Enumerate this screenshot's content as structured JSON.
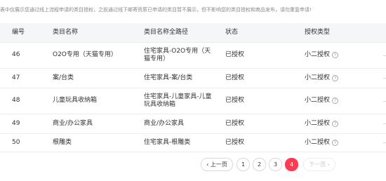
{
  "notice": "表中仅展示您通过线上流程申请的类目授权，之前通过线下邮寄资质已申请的类目暂不展示，但不影响您的类目授权和商品发布，请勿重复申请!",
  "table": {
    "columns": [
      "编号",
      "类目名称",
      "类目名称全路径",
      "状态",
      "授权类型"
    ],
    "rows": [
      {
        "id": "46",
        "name": "O2O专用（天猫专用）",
        "path": "住宅家具-O2O专用（天猫专用）",
        "status": "已授权",
        "type": "小二授权"
      },
      {
        "id": "47",
        "name": "案/台类",
        "path": "住宅家具-案/台类",
        "status": "已授权",
        "type": "小二授权"
      },
      {
        "id": "48",
        "name": "儿童玩具收纳箱",
        "path": "住宅家具-儿童家具-儿童玩具收纳箱",
        "status": "已授权",
        "type": "小二授权"
      },
      {
        "id": "49",
        "name": "商业/办公家具",
        "path": "商业/办公家具",
        "status": "已授权",
        "type": "小二授权"
      },
      {
        "id": "50",
        "name": "根雕类",
        "path": "住宅家具-根雕类",
        "status": "已授权",
        "type": "小二授权"
      }
    ],
    "help_glyph": "?"
  },
  "pagination": {
    "prev": "‹ 上一页",
    "pages": [
      "1",
      "2",
      "3",
      "4"
    ],
    "current": "4",
    "next": "下一页 ›"
  },
  "colors": {
    "accent": "#ff3b54",
    "header_bg": "#f5f6f8",
    "border": "#ebecef"
  },
  "icons": [
    "question-circle-icon"
  ]
}
